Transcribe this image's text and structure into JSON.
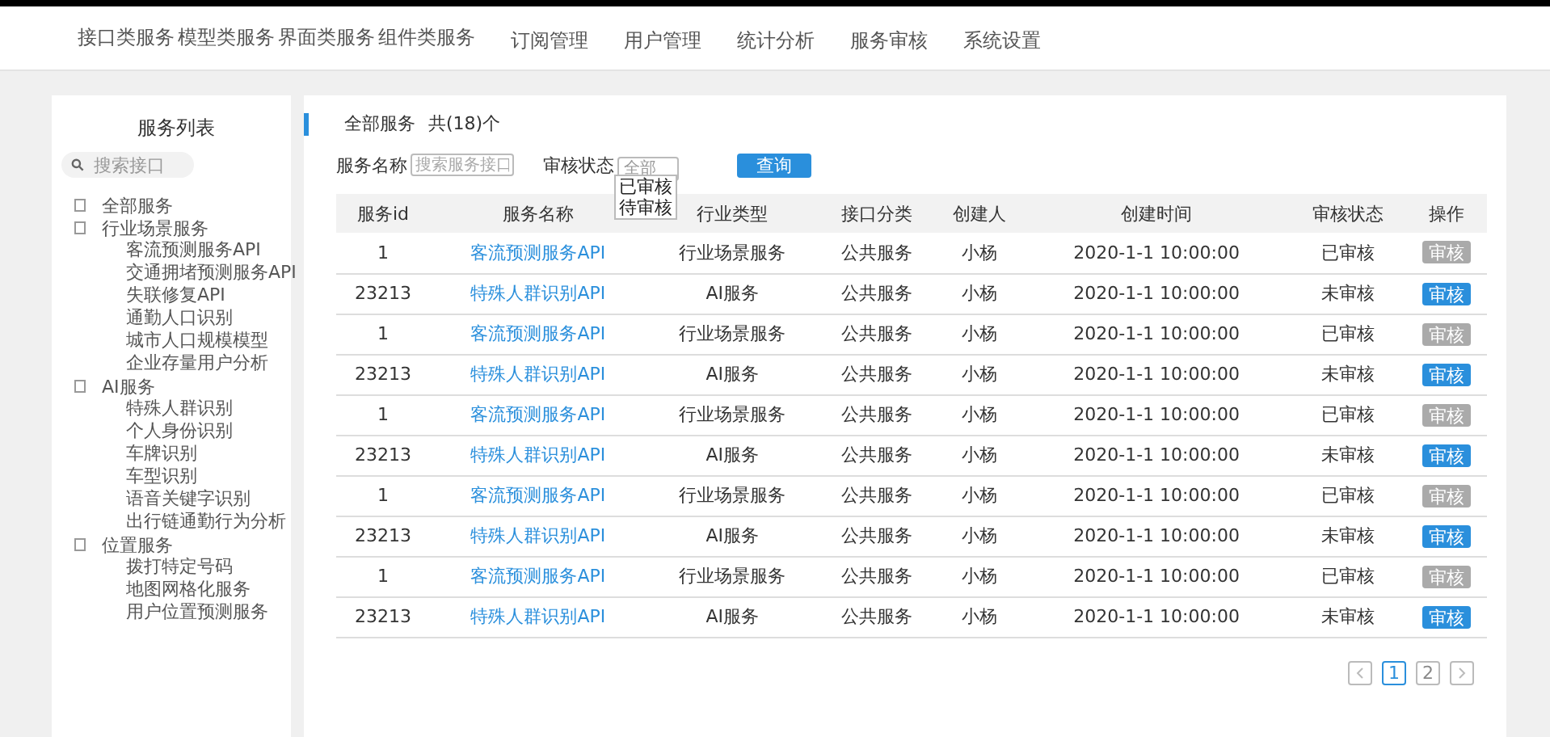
{
  "nav": {
    "items": [
      {
        "label": "接口类服务",
        "selected": false
      },
      {
        "label": "模型类服务",
        "selected": false
      },
      {
        "label": "界面类服务",
        "selected": false
      },
      {
        "label": "组件类服务",
        "selected": false
      },
      {
        "label": "订阅管理",
        "selected": false
      },
      {
        "label": "用户管理",
        "selected": false
      },
      {
        "label": "统计分析",
        "selected": false
      },
      {
        "label": "服务审核",
        "selected": false
      },
      {
        "label": "系统设置",
        "selected": false
      }
    ]
  },
  "sidebar": {
    "title": "服务列表",
    "search": {
      "placeholder": "搜索接口"
    },
    "tree": [
      {
        "label": "全部服务"
      },
      {
        "label": "行业场景服务",
        "children": [
          {
            "label": "客流预测服务API"
          },
          {
            "label": "交通拥堵预测服务API"
          },
          {
            "label": "失联修复API"
          },
          {
            "label": "通勤人口识别"
          },
          {
            "label": "城市人口规模模型"
          },
          {
            "label": "企业存量用户分析"
          }
        ]
      },
      {
        "label": "AI服务",
        "children": [
          {
            "label": "特殊人群识别"
          },
          {
            "label": "个人身份识别"
          },
          {
            "label": "车牌识别"
          },
          {
            "label": "车型识别"
          },
          {
            "label": "语音关键字识别"
          },
          {
            "label": "出行链通勤行为分析"
          }
        ]
      },
      {
        "label": "位置服务",
        "children": [
          {
            "label": "拨打特定号码"
          },
          {
            "label": "地图网格化服务"
          },
          {
            "label": "用户位置预测服务"
          }
        ]
      }
    ]
  },
  "main": {
    "heading": "全部服务",
    "count": "共(18)个",
    "filters": {
      "name_label": "服务名称",
      "name_placeholder": "搜索服务接口",
      "status_label": "审核状态",
      "status_value": "全部",
      "status_options": [
        "已审核",
        "待审核"
      ],
      "query_button": "查询"
    },
    "table": {
      "columns": [
        "服务id",
        "服务名称",
        "行业类型",
        "接口分类",
        "创建人",
        "创建时间",
        "审核状态",
        "操作"
      ],
      "rows": [
        {
          "id": "1",
          "name": "客流预测服务API",
          "type": "行业场景服务",
          "category": "公共服务",
          "creator": "小杨",
          "time": "2020-1-1 10:00:00",
          "status": "已审核",
          "reviewed": true,
          "action": "审核"
        },
        {
          "id": "23213",
          "name": "特殊人群识别API",
          "type": "AI服务",
          "category": "公共服务",
          "creator": "小杨",
          "time": "2020-1-1 10:00:00",
          "status": "未审核",
          "reviewed": false,
          "action": "审核"
        },
        {
          "id": "1",
          "name": "客流预测服务API",
          "type": "行业场景服务",
          "category": "公共服务",
          "creator": "小杨",
          "time": "2020-1-1 10:00:00",
          "status": "已审核",
          "reviewed": true,
          "action": "审核"
        },
        {
          "id": "23213",
          "name": "特殊人群识别API",
          "type": "AI服务",
          "category": "公共服务",
          "creator": "小杨",
          "time": "2020-1-1 10:00:00",
          "status": "未审核",
          "reviewed": false,
          "action": "审核"
        },
        {
          "id": "1",
          "name": "客流预测服务API",
          "type": "行业场景服务",
          "category": "公共服务",
          "creator": "小杨",
          "time": "2020-1-1 10:00:00",
          "status": "已审核",
          "reviewed": true,
          "action": "审核"
        },
        {
          "id": "23213",
          "name": "特殊人群识别API",
          "type": "AI服务",
          "category": "公共服务",
          "creator": "小杨",
          "time": "2020-1-1 10:00:00",
          "status": "未审核",
          "reviewed": false,
          "action": "审核"
        },
        {
          "id": "1",
          "name": "客流预测服务API",
          "type": "行业场景服务",
          "category": "公共服务",
          "creator": "小杨",
          "time": "2020-1-1 10:00:00",
          "status": "已审核",
          "reviewed": true,
          "action": "审核"
        },
        {
          "id": "23213",
          "name": "特殊人群识别API",
          "type": "AI服务",
          "category": "公共服务",
          "creator": "小杨",
          "time": "2020-1-1 10:00:00",
          "status": "未审核",
          "reviewed": false,
          "action": "审核"
        },
        {
          "id": "1",
          "name": "客流预测服务API",
          "type": "行业场景服务",
          "category": "公共服务",
          "creator": "小杨",
          "time": "2020-1-1 10:00:00",
          "status": "已审核",
          "reviewed": true,
          "action": "审核"
        },
        {
          "id": "23213",
          "name": "特殊人群识别API",
          "type": "AI服务",
          "category": "公共服务",
          "creator": "小杨",
          "time": "2020-1-1 10:00:00",
          "status": "未审核",
          "reviewed": false,
          "action": "审核"
        }
      ]
    },
    "pagination": {
      "pages": [
        {
          "label": "1",
          "selected": true
        },
        {
          "label": "2",
          "selected": false
        }
      ]
    }
  }
}
